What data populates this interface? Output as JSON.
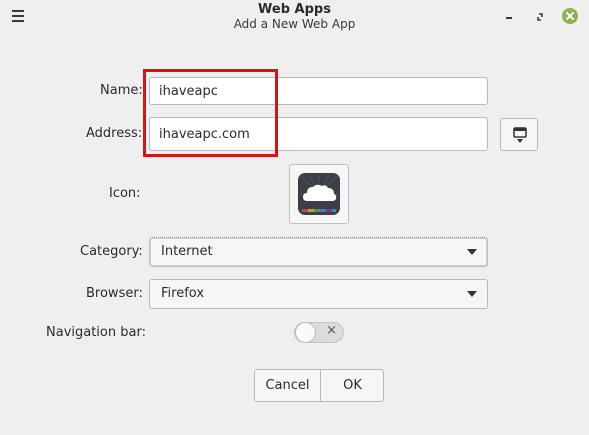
{
  "window": {
    "title": "Web Apps",
    "subtitle": "Add a New Web App"
  },
  "form": {
    "name_label": "Name:",
    "name_value": "ihaveapc",
    "address_label": "Address:",
    "address_value": "ihaveapc.com",
    "icon_label": "Icon:",
    "category_label": "Category:",
    "category_value": "Internet",
    "browser_label": "Browser:",
    "browser_value": "Firefox",
    "navbar_label": "Navigation bar:",
    "navbar_enabled": false
  },
  "buttons": {
    "cancel": "Cancel",
    "ok": "OK"
  },
  "icons": {
    "menu": "hamburger-menu-icon",
    "minimize": "minimize-icon",
    "restore": "restore-icon",
    "close": "close-icon",
    "favicon": "download-favicon-icon",
    "app_icon": "cloud-app-icon"
  },
  "colors": {
    "close_button": "#8ab251",
    "highlight_box": "#d01616"
  }
}
